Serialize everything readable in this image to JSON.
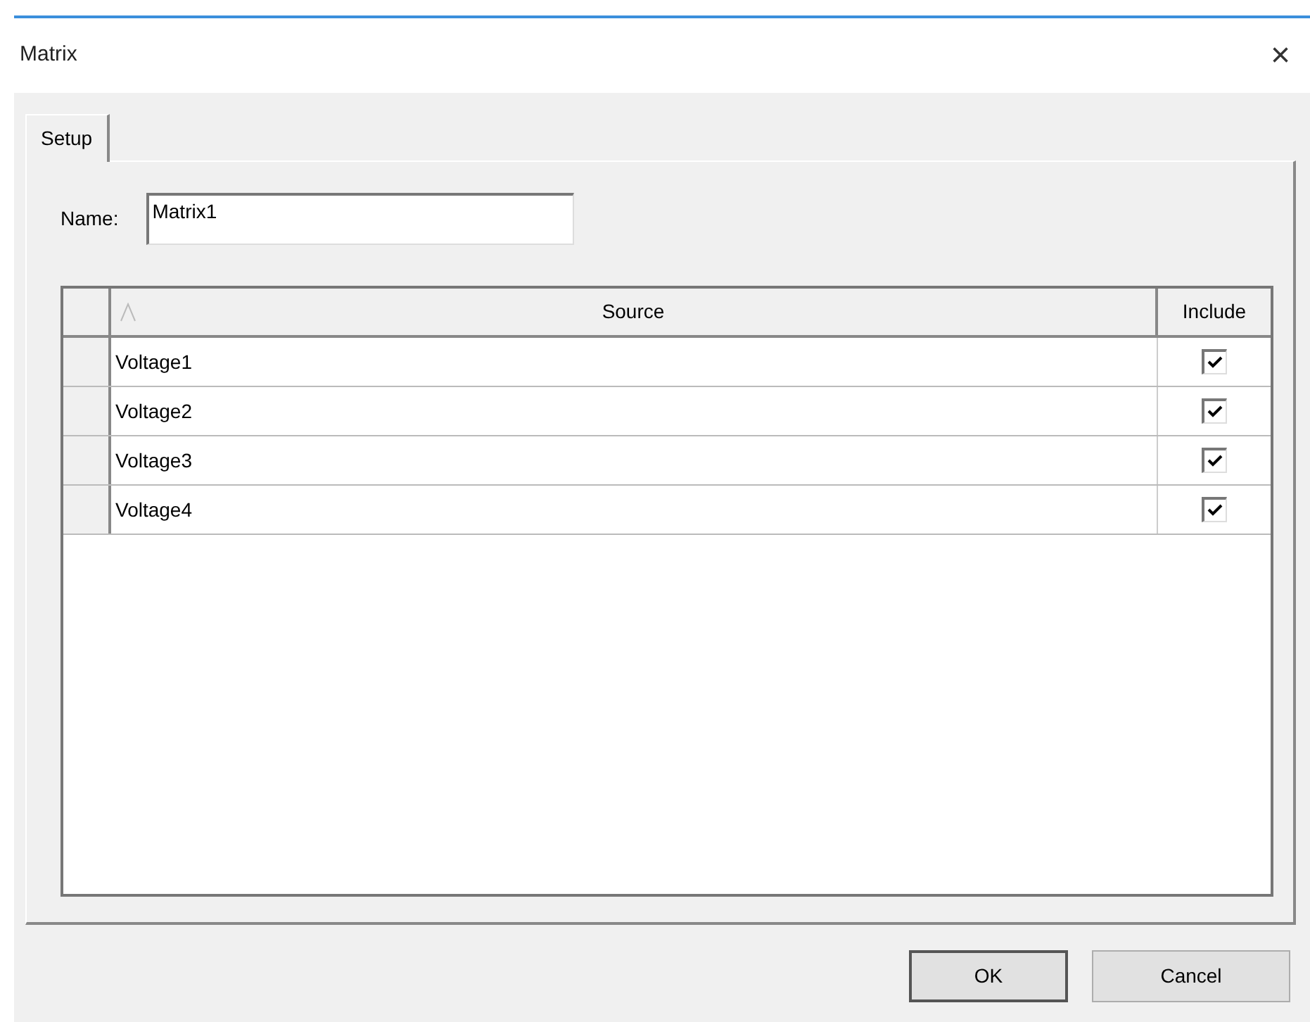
{
  "window": {
    "title": "Matrix",
    "close": "×"
  },
  "tabs": [
    {
      "label": "Setup",
      "selected": true
    }
  ],
  "name_field": {
    "label": "Name:",
    "value": "Matrix1"
  },
  "table": {
    "columns": [
      "Source",
      "Include"
    ],
    "rows": [
      {
        "source": "Voltage1",
        "include": true
      },
      {
        "source": "Voltage2",
        "include": true
      },
      {
        "source": "Voltage3",
        "include": true
      },
      {
        "source": "Voltage4",
        "include": true
      }
    ]
  },
  "buttons": [
    "OK",
    "Cancel"
  ]
}
